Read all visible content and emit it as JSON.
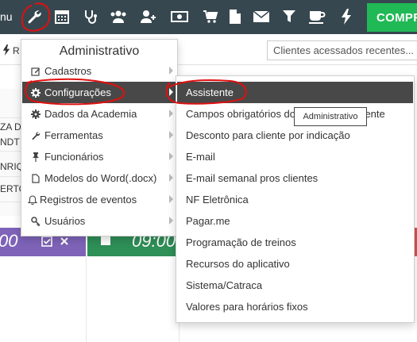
{
  "navbar": {
    "partial_left_text": "nu",
    "icons": [
      "wrench-icon",
      "calendar-icon",
      "stethoscope-icon",
      "users-icon",
      "user-plus-icon",
      "money-icon",
      "cart-icon",
      "file-icon",
      "envelope-icon",
      "filter-icon",
      "coffee-icon",
      "bolt-icon"
    ],
    "buy_button": "COMPR"
  },
  "subbar": {
    "r_label": "R",
    "clients_input": "Clientes acessados recentes..."
  },
  "background": {
    "partial_texts": [
      "ZA D",
      "NDT",
      "NRIQ",
      "ERTO"
    ],
    "times": [
      "00",
      "09:00"
    ]
  },
  "menu": {
    "title": "Administrativo",
    "items": [
      {
        "label": "Cadastros",
        "icon": "edit-icon"
      },
      {
        "label": "Configurações",
        "icon": "gear-icon"
      },
      {
        "label": "Dados da Academia",
        "icon": "cog-icon"
      },
      {
        "label": "Ferramentas",
        "icon": "wrench-icon"
      },
      {
        "label": "Funcionários",
        "icon": "pin-icon"
      },
      {
        "label": "Modelos do Word(.docx)",
        "icon": "file-icon"
      },
      {
        "label": "Registros de eventos",
        "icon": "bell-icon"
      },
      {
        "label": "Usuários",
        "icon": "key-icon"
      }
    ]
  },
  "submenu": {
    "items": [
      "Assistente",
      "Campos obrigatórios do cadastro de cliente",
      "Desconto para cliente por indicação",
      "E-mail",
      "E-mail semanal pros clientes",
      "NF Eletrônica",
      "Pagar.me",
      "Programação de treinos",
      "Recursos do aplicativo",
      "Sistema/Catraca",
      "Valores para horários fixos"
    ]
  },
  "tooltip": "Administrativo",
  "colors": {
    "navbar": "#37474f",
    "buy_button": "#20b955",
    "menu_active": "#484848",
    "annotation": "#e01010",
    "purple": "#7e63b8",
    "green": "#2e8f57"
  }
}
